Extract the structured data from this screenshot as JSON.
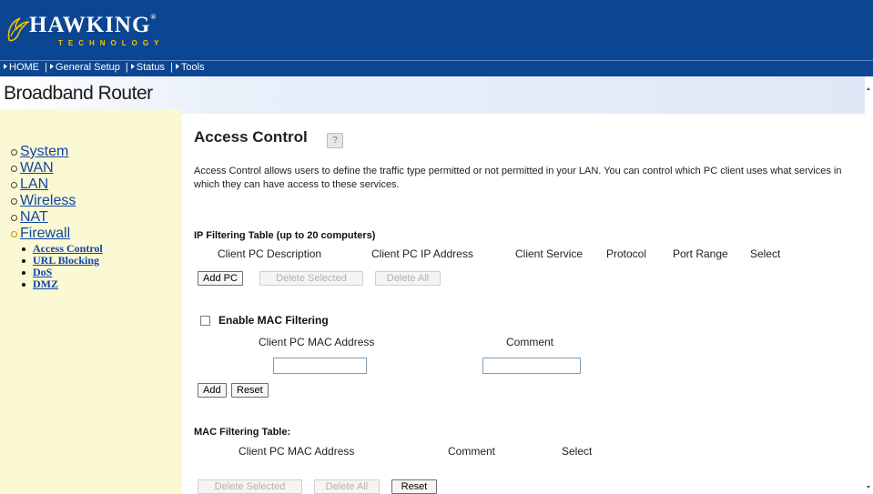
{
  "brand": {
    "name": "HAWKING",
    "registered_mark": "®",
    "tagline": "TECHNOLOGY",
    "accent_color": "#f2c200",
    "bar_color": "#0c4692"
  },
  "nav": {
    "items": [
      "HOME",
      "General Setup",
      "Status",
      "Tools"
    ],
    "separator": "|"
  },
  "product_title": "Broadband Router",
  "sidebar": {
    "items": [
      {
        "label": "System"
      },
      {
        "label": "WAN"
      },
      {
        "label": "LAN"
      },
      {
        "label": "Wireless"
      },
      {
        "label": "NAT"
      },
      {
        "label": "Firewall"
      }
    ],
    "firewall_sub": [
      {
        "label": "Access Control"
      },
      {
        "label": "URL Blocking"
      },
      {
        "label": "DoS"
      },
      {
        "label": "DMZ"
      }
    ]
  },
  "page": {
    "title": "Access Control",
    "help_icon": "help-icon",
    "description": "Access Control allows users to define the traffic type permitted or not permitted in your LAN. You can control which PC client uses what services in which they can have access to these services."
  },
  "ip_table": {
    "heading": "IP Filtering Table (up to 20 computers)",
    "columns": [
      "Client PC Description",
      "Client PC IP Address",
      "Client Service",
      "Protocol",
      "Port Range",
      "Select"
    ],
    "add_pc_label": "Add PC",
    "delete_selected_label": "Delete Selected",
    "delete_all_label": "Delete All"
  },
  "mac_filter": {
    "enable_label": "Enable MAC Filtering",
    "enabled": false,
    "mac_column": "Client PC MAC Address",
    "comment_column": "Comment",
    "mac_value": "",
    "comment_value": "",
    "add_label": "Add",
    "reset_label": "Reset"
  },
  "mac_table": {
    "heading": "MAC Filtering Table:",
    "columns": [
      "Client PC MAC Address",
      "Comment",
      "Select"
    ],
    "delete_selected_label": "Delete Selected",
    "delete_all_label": "Delete All",
    "reset_label": "Reset"
  }
}
